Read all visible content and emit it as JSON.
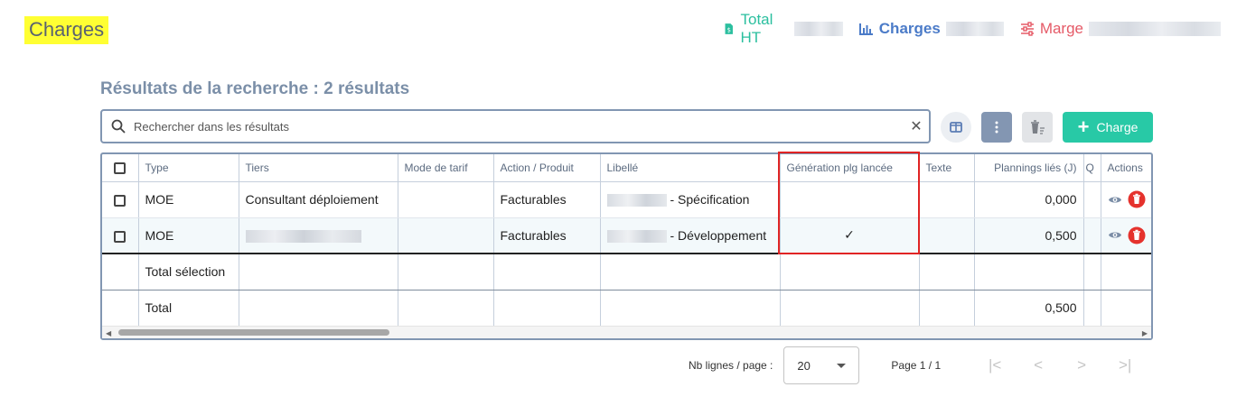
{
  "page": {
    "title": "Charges"
  },
  "kpis": {
    "total_ht": {
      "label": "Total HT",
      "color": "#2bbf9f",
      "icon": "dollar-file-icon"
    },
    "charges": {
      "label": "Charges",
      "color": "#4b7bc8",
      "icon": "bar-chart-icon"
    },
    "marge": {
      "label": "Marge",
      "color": "#e55a67",
      "icon": "sliders-icon"
    }
  },
  "results": {
    "title": "Résultats de la recherche : 2 résultats"
  },
  "search": {
    "placeholder": "Rechercher dans les résultats",
    "clear": "✕"
  },
  "toolbar": {
    "add_label": "Charge",
    "add_color": "#28c9a6"
  },
  "table": {
    "columns": [
      "Type",
      "Tiers",
      "Mode de tarif",
      "Action / Produit",
      "Libellé",
      "Génération plg lancée",
      "Texte",
      "Plannings liés (J)",
      "Q",
      "Actions"
    ],
    "rows": [
      {
        "type": "MOE",
        "tiers": "Consultant déploiement",
        "mode_tarif": "",
        "action_produit": "Facturables",
        "libelle": "- Spécification",
        "generation": "",
        "texte": "",
        "plannings": "0,000"
      },
      {
        "type": "MOE",
        "tiers": "",
        "mode_tarif": "",
        "action_produit": "Facturables",
        "libelle": "- Développement",
        "generation": "✓",
        "texte": "",
        "plannings": "0,500"
      }
    ],
    "total_selection": {
      "label": "Total sélection",
      "plannings": ""
    },
    "total": {
      "label": "Total",
      "plannings": "0,500"
    }
  },
  "pagination": {
    "rows_label": "Nb lignes / page :",
    "rows_per_page": "20",
    "page_info": "Page 1 / 1"
  }
}
